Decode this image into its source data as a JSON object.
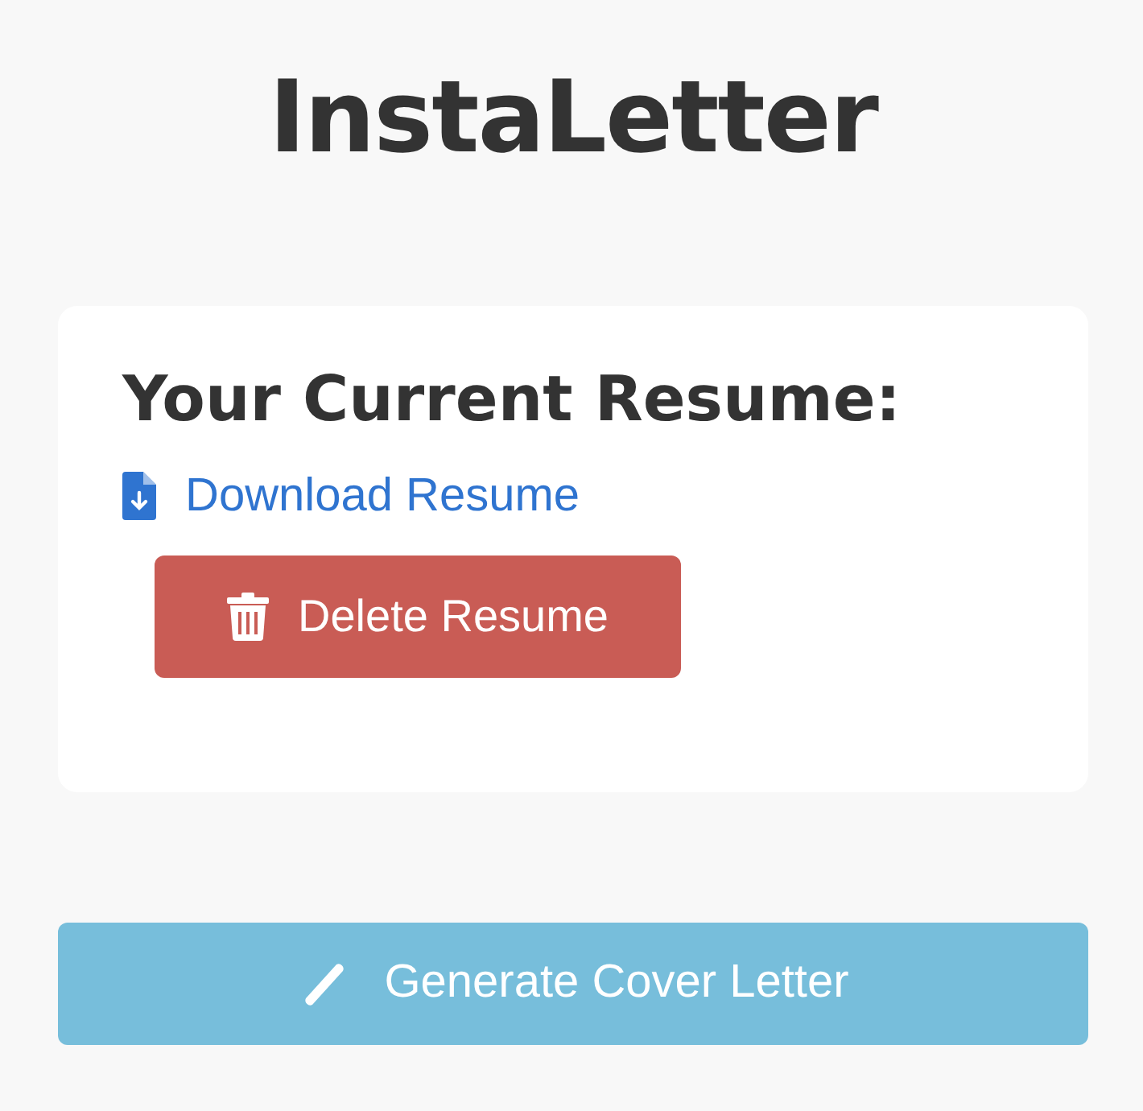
{
  "title": "InstaLetter",
  "resume_card": {
    "heading": "Your Current Resume:",
    "download_link": "Download Resume",
    "delete_button": "Delete Resume"
  },
  "generate_button": "Generate Cover Letter"
}
